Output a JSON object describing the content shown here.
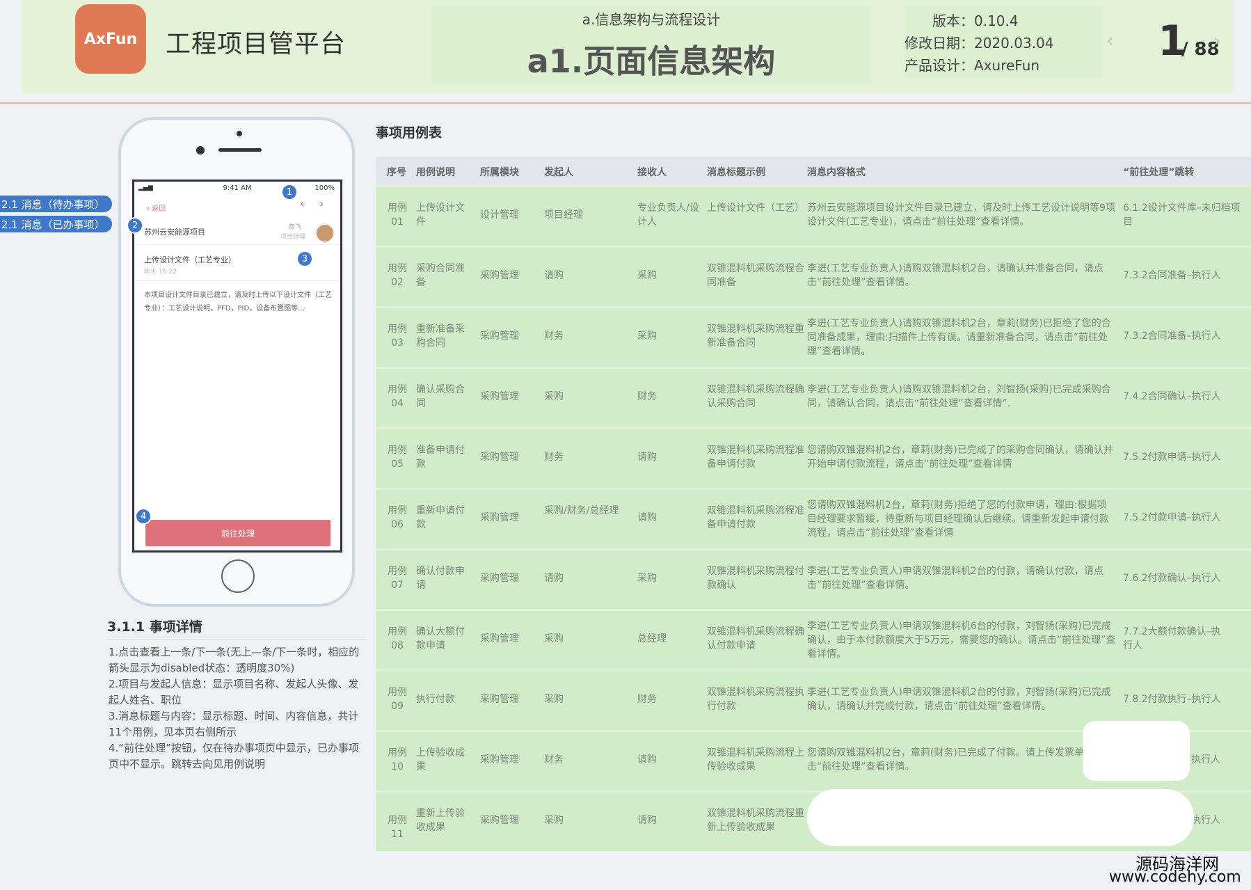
{
  "header": {
    "logo_text": "AxFun",
    "app_title": "工程项目管平台",
    "section_title": "a.信息架构与流程设计",
    "page_title": "a1.页面信息架构",
    "version": "版本：0.10.4",
    "modified": "修改日期：2020.03.04",
    "designer": "产品设计：AxureFun",
    "page_current": "1",
    "page_total": "/ 88",
    "prev_icon": "‹",
    "next_icon": "›"
  },
  "phone": {
    "status_time": "9:41 AM",
    "status_battery": "100%",
    "back_label": "返回",
    "project_name": "苏州云安能源项目",
    "initiator_name": "颜飞",
    "initiator_role": "项目经理",
    "message_title": "上传设计文件（工艺专业）",
    "message_time": "昨天 16:22",
    "message_body": "本项目设计文件目录已建立，请及时上传以下设计文件（工艺专业）：工艺设计说明，PFD，PID，设备布置图等…",
    "go_button": "前往处理",
    "markers": [
      "1",
      "2",
      "3",
      "4"
    ],
    "tags": [
      "2.1 消息（待办事项）",
      "2.1 消息（已办事项）"
    ]
  },
  "notes": {
    "title": "3.1.1 事项详情",
    "items": [
      "1.点击查看上一条/下一条(无上—条/下一条时，相应的箭头显示为disabled状态：透明度30%)",
      "2.项目与发起人信息：显示项目名称、发起人头像、发起人姓名、职位",
      "3.消息标题与内容：显示标题、时间、内容信息，共计11个用例，见本页右侧所示",
      "4.“前往处理”按钮，仅在待办事项页中显示，已办事项页中不显示。跳转去向见用例说明"
    ]
  },
  "table": {
    "title": "事项用例表",
    "headers": [
      "序号",
      "用例说明",
      "所属模块",
      "发起人",
      "接收人",
      "消息标题示例",
      "消息内容格式",
      "“前往处理”跳转"
    ],
    "rows": [
      {
        "id": "用例 01",
        "name": "上传设计文件",
        "module": "设计管理",
        "initiator": "项目经理",
        "receiver": "专业负责人/设计人",
        "subject": "上传设计文件（工艺）",
        "body": "苏州云安能源项目设计文件目录已建立，请及时上传工艺设计说明等9项设计文件(工艺专业)，请点击“前往处理”查看详情。",
        "link": "6.1.2设计文件库–未归档项目"
      },
      {
        "id": "用例 02",
        "name": "采购合同准备",
        "module": "采购管理",
        "initiator": "请购",
        "receiver": "采购",
        "subject": "双锥混料机采购流程合同准备",
        "body": "李进(工艺专业负责人)请购双锥混料机2台，请确认并准备合同，请点击“前往处理”查看详情。",
        "link": "7.3.2合同准备–执行人"
      },
      {
        "id": "用例 03",
        "name": "重新准备采购合同",
        "module": "采购管理",
        "initiator": "财务",
        "receiver": "采购",
        "subject": "双锥混料机采购流程重新准备合同",
        "body": "李进(工艺专业负责人)请购双锥混料机2台，章莉(财务)已拒绝了您的合同准备成果，理由:扫描件上传有误。请重新准备合同，请点击“前往处理”查看详情。",
        "link": "7.3.2合同准备–执行人"
      },
      {
        "id": "用例 04",
        "name": "确认采购合同",
        "module": "采购管理",
        "initiator": "采购",
        "receiver": "财务",
        "subject": "双锥混料机采购流程确认采购合同",
        "body": "李进(工艺专业负责人)请购双锥混料机2台，刘智扬(采购)已完成采购合同，请确认合同，请点击“前往处理”查看详情”.",
        "link": "7.4.2合同确认–执行人"
      },
      {
        "id": "用例 05",
        "name": "准备申请付款",
        "module": "采购管理",
        "initiator": "财务",
        "receiver": "请购",
        "subject": "双锥混料机采购流程准备申请付款",
        "body": "您请购双锥混料机2台，章莉(财务)已完成了的采购合同确认，请确认并开始申请付款流程，请点击“前往处理”查看详情",
        "link": "7.5.2付款申请–执行人"
      },
      {
        "id": "用例 06",
        "name": "重新申请付款",
        "module": "采购管理",
        "initiator": "采购/财务/总经理",
        "receiver": "请购",
        "subject": "双锥混料机采购流程准备申请付款",
        "body": "您请购双锥混料机2台，章莉(财务)拒绝了您的付款申请，理由:根据项目经理要求暂缓，待重新与项目经理确认后继续。请重新发起申请付款流程，请点击“前往处理”查看详情",
        "link": "7.5.2付款申请–执行人"
      },
      {
        "id": "用例 07",
        "name": "确认付款申请",
        "module": "采购管理",
        "initiator": "请购",
        "receiver": "采购",
        "subject": "双锥混料机采购流程付款确认",
        "body": "李进(工艺专业负责人)申请双锥混料机2台的付款，请确认付款，请点击“前往处理”查看详情。",
        "link": "7.6.2付款确认–执行人"
      },
      {
        "id": "用例 08",
        "name": "确认大额付款申请",
        "module": "采购管理",
        "initiator": "采购",
        "receiver": "总经理",
        "subject": "双锥混料机采购流程确认付款申请",
        "body": "李进(工艺专业负责人)申请双锥混料机6台的付款，刘智扬(采购)已完成确认，由于本付款额度大于5万元，需要您的确认。请点击“前往处理”查看详情。",
        "link": "7.7.2大额付款确认–执行人"
      },
      {
        "id": "用例 09",
        "name": "执行付款",
        "module": "采购管理",
        "initiator": "采购",
        "receiver": "财务",
        "subject": "双锥混料机采购流程执行付款",
        "body": "李进(工艺专业负责人)申请双锥混料机2台的付款，刘智扬(采购)已完成确认，请确认并完成付款，请点击“前往处理”查看详情。",
        "link": "7.8.2付款执行–执行人"
      },
      {
        "id": "用例 10",
        "name": "上传验收成果",
        "module": "采购管理",
        "initiator": "财务",
        "receiver": "请购",
        "subject": "双锥混料机采购流程上传验收成果",
        "body": "您请购双锥混料机2台，章莉(财务)已完成了付款。请上传发票单,请点击“前往处理”查看详情。",
        "link": "执行人"
      },
      {
        "id": "用例11",
        "name": "重新上传验收成果",
        "module": "采购管理",
        "initiator": "采购",
        "receiver": "请购",
        "subject": "双锥混料机采购流程重新上传验收成果",
        "body": "",
        "link": "执行人"
      }
    ]
  },
  "watermark": {
    "cn": "源码海洋网",
    "url": "www.codehy.com"
  },
  "colors": {
    "logo_bg": "#e07a54",
    "header_bg": "#e4f2d8",
    "row_bg": "#d0ecc8",
    "marker_blue": "#3f78c8",
    "go_button_bg": "#e0707a"
  }
}
